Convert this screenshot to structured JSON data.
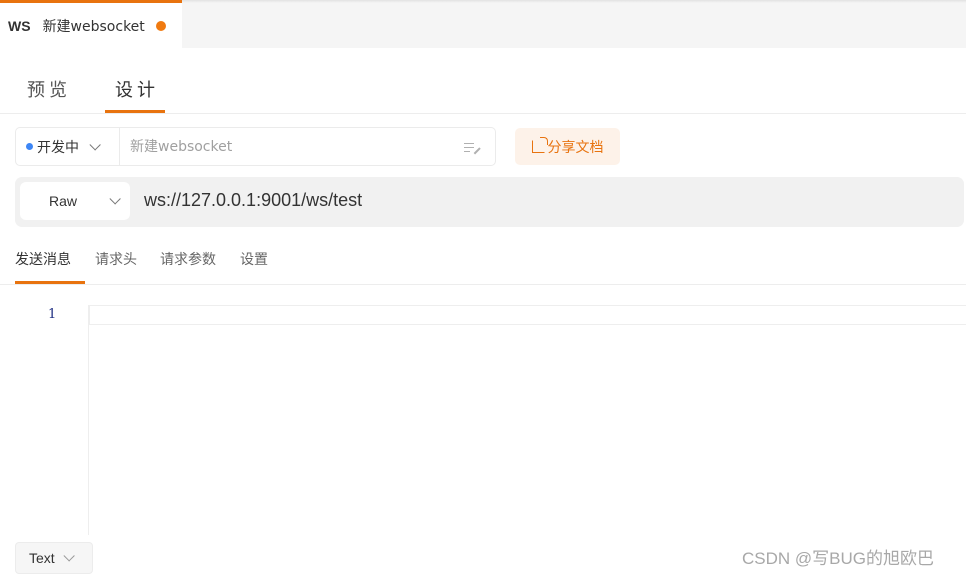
{
  "tab": {
    "protocol": "WS",
    "title": "新建websocket",
    "unsaved_color": "#f07a10"
  },
  "mode_tabs": [
    {
      "label": "预览",
      "active": false
    },
    {
      "label": "设计",
      "active": true
    }
  ],
  "meta": {
    "status": {
      "label": "开发中",
      "dot_color": "#3d86f5"
    },
    "name_placeholder": "新建websocket",
    "share_button": "分享文档"
  },
  "request": {
    "method": "Raw",
    "url": "ws://127.0.0.1:9001/ws/test"
  },
  "sub_tabs": [
    {
      "label": "发送消息",
      "active": true
    },
    {
      "label": "请求头",
      "active": false
    },
    {
      "label": "请求参数",
      "active": false
    },
    {
      "label": "设置",
      "active": false
    }
  ],
  "editor": {
    "line_numbers": [
      "1"
    ],
    "content": ""
  },
  "format": {
    "label": "Text"
  },
  "watermark": "CSDN @写BUG的旭欧巴",
  "accent_color": "#e8730f"
}
